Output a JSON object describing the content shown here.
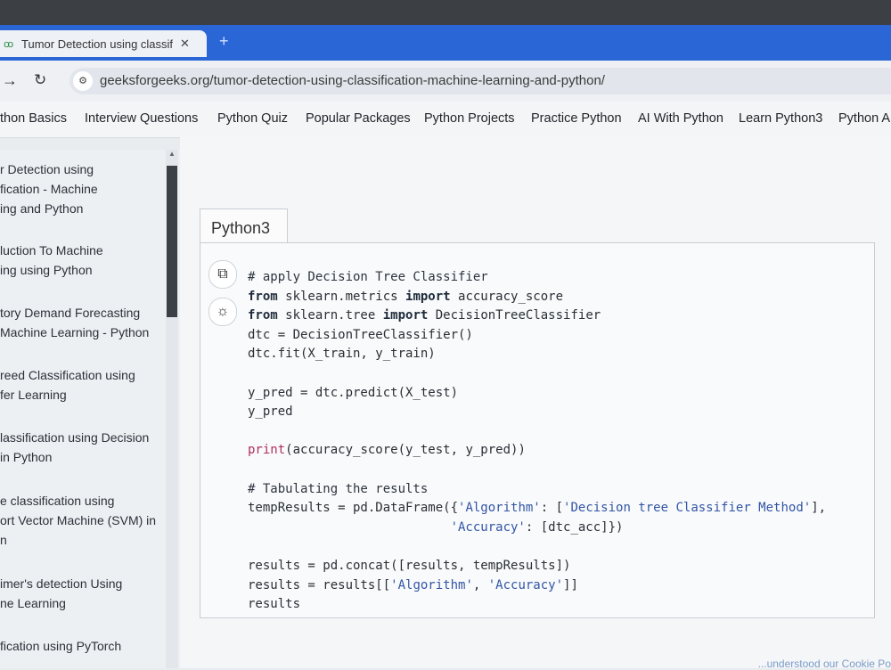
{
  "browser": {
    "tab_title": "Tumor Detection using classific",
    "tab_favicon": "gfg-icon",
    "close_glyph": "✕",
    "new_tab_glyph": "+",
    "url": "geeksforgeeks.org/tumor-detection-using-classification-machine-learning-and-python/"
  },
  "menu": [
    "thon Basics",
    "Interview Questions",
    "Python Quiz",
    "Popular Packages",
    "Python Projects",
    "Practice Python",
    "AI With Python",
    "Learn Python3",
    "Python A"
  ],
  "sidebar": [
    {
      "line1": "r Detection using",
      "line2": "fication - Machine",
      "line3": "ing and Python"
    },
    {
      "line1": "luction To Machine",
      "line2": "ing using Python"
    },
    {
      "line1": "tory Demand Forecasting",
      "line2": "Machine Learning - Python"
    },
    {
      "line1": "reed Classification using",
      "line2": "fer Learning"
    },
    {
      "line1": "lassification using Decision",
      "line2": "in Python"
    },
    {
      "line1": "e classification using",
      "line2": "ort Vector Machine (SVM) in",
      "line3": "n"
    },
    {
      "line1": "imer's detection Using",
      "line2": "ne Learning"
    },
    {
      "line1": "fication using PyTorch"
    }
  ],
  "code_block": {
    "language": "Python3",
    "lines": [
      "# apply Decision Tree Classifier",
      "from sklearn.metrics import accuracy_score",
      "from sklearn.tree import DecisionTreeClassifier",
      "dtc = DecisionTreeClassifier()",
      "dtc.fit(X_train, y_train)",
      "",
      "y_pred = dtc.predict(X_test)",
      "y_pred",
      "",
      "print(accuracy_score(y_test, y_pred))",
      "",
      "# Tabulating the results",
      "tempResults = pd.DataFrame({'Algorithm': ['Decision tree Classifier Method'],",
      "                           'Accuracy': [dtc_acc]})",
      "",
      "results = pd.concat([results, tempResults])",
      "results = results[['Algorithm', 'Accuracy']]",
      "results"
    ]
  },
  "footer": {
    "cookie_text": "...understood our Cookie Po"
  },
  "colors": {
    "tab_bar": "#2b66d6",
    "keyword": "#1e2a3a",
    "function": "#b0305a",
    "string": "#3255a6"
  }
}
